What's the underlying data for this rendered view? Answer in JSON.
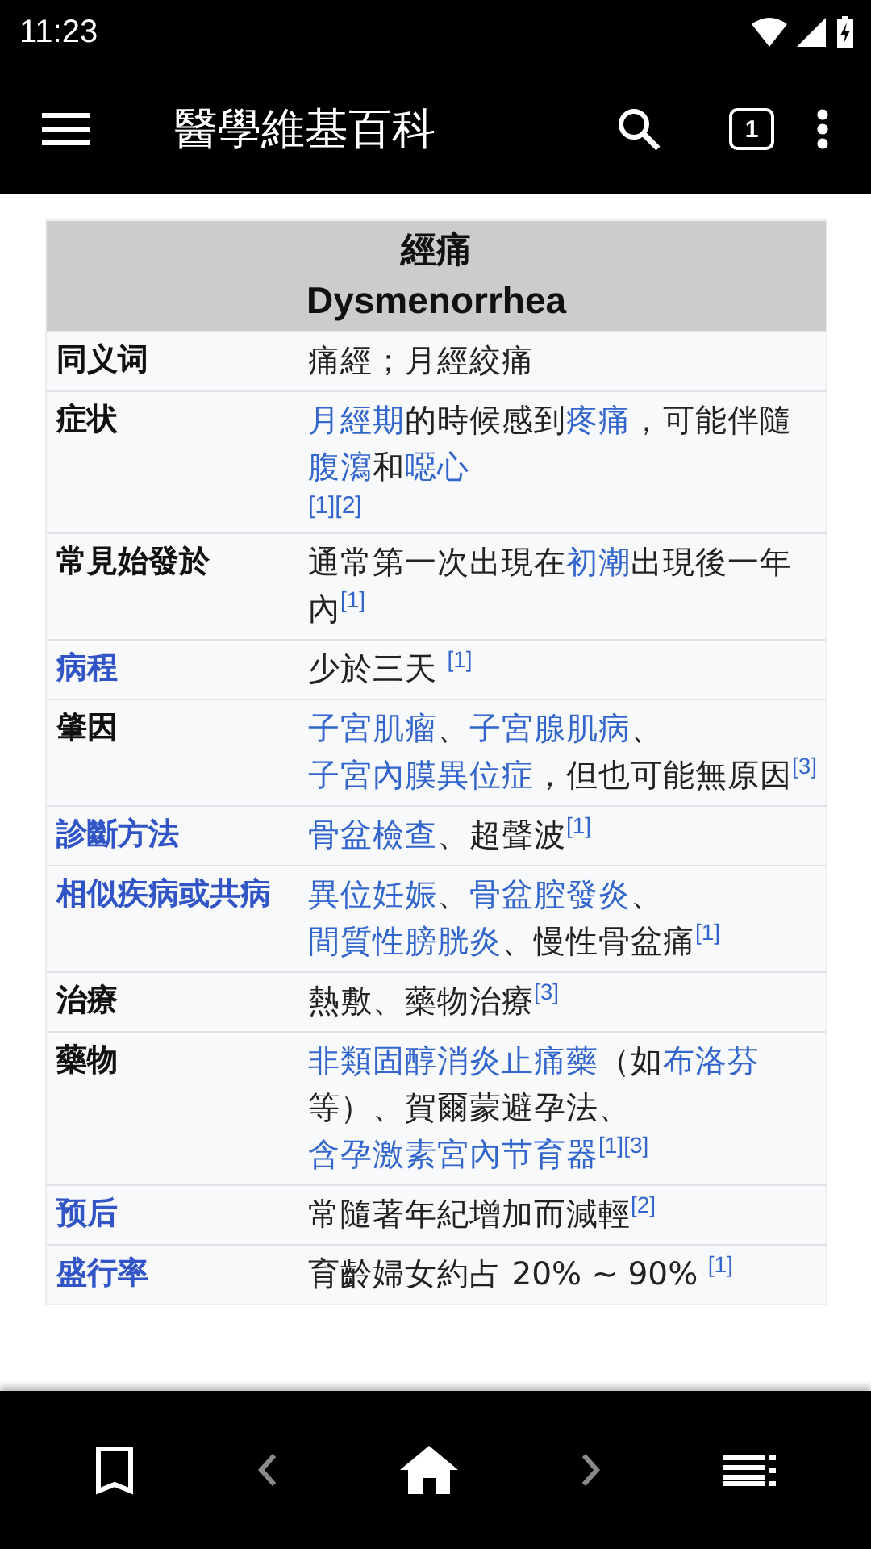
{
  "status_bar": {
    "time": "11:23"
  },
  "app_bar": {
    "title": "醫學維基百科",
    "tab_count": "1"
  },
  "infobox": {
    "title": "經痛",
    "subtitle": "Dysmenorrhea",
    "rows": [
      {
        "label": "同义词",
        "label_link": false,
        "value": [
          {
            "kind": "plain",
            "text": "痛經；月經絞痛"
          }
        ]
      },
      {
        "label": "症状",
        "label_link": false,
        "value": [
          {
            "kind": "link",
            "text": "月經期"
          },
          {
            "kind": "plain",
            "text": "的時候感到"
          },
          {
            "kind": "link",
            "text": "疼痛"
          },
          {
            "kind": "plain",
            "text": "，可能伴隨"
          },
          {
            "kind": "link",
            "text": "腹瀉"
          },
          {
            "kind": "plain",
            "text": "和"
          },
          {
            "kind": "link",
            "text": "噁心"
          },
          {
            "kind": "refline",
            "text": "[1][2]"
          }
        ]
      },
      {
        "label": "常見始發於",
        "label_link": false,
        "value": [
          {
            "kind": "plain",
            "text": "通常第一次出現在"
          },
          {
            "kind": "link",
            "text": "初潮"
          },
          {
            "kind": "plain",
            "text": "出現後一年內"
          },
          {
            "kind": "ref",
            "text": "[1]"
          }
        ]
      },
      {
        "label": "病程",
        "label_link": true,
        "value": [
          {
            "kind": "plain",
            "text": "少於三天 "
          },
          {
            "kind": "ref",
            "text": "[1]"
          }
        ]
      },
      {
        "label": "肇因",
        "label_link": false,
        "value": [
          {
            "kind": "link",
            "text": "子宮肌瘤"
          },
          {
            "kind": "plain",
            "text": "、"
          },
          {
            "kind": "link",
            "text": "子宮腺肌病"
          },
          {
            "kind": "plain",
            "text": "、"
          },
          {
            "kind": "link",
            "text": "子宮內膜異位症"
          },
          {
            "kind": "plain",
            "text": "，但也可能無原因"
          },
          {
            "kind": "ref",
            "text": "[3]"
          }
        ]
      },
      {
        "label": "診斷方法",
        "label_link": true,
        "value": [
          {
            "kind": "link",
            "text": "骨盆檢查"
          },
          {
            "kind": "plain",
            "text": "、超聲波"
          },
          {
            "kind": "ref",
            "text": "[1]"
          }
        ]
      },
      {
        "label": "相似疾病或共病",
        "label_link": true,
        "value": [
          {
            "kind": "link",
            "text": "異位妊娠"
          },
          {
            "kind": "plain",
            "text": "、"
          },
          {
            "kind": "link",
            "text": "骨盆腔發炎"
          },
          {
            "kind": "plain",
            "text": "、"
          },
          {
            "kind": "link",
            "text": "間質性膀胱炎"
          },
          {
            "kind": "plain",
            "text": "、慢性骨盆痛"
          },
          {
            "kind": "ref",
            "text": "[1]"
          }
        ]
      },
      {
        "label": "治療",
        "label_link": false,
        "value": [
          {
            "kind": "plain",
            "text": "熱敷、藥物治療"
          },
          {
            "kind": "ref",
            "text": "[3]"
          }
        ]
      },
      {
        "label": "藥物",
        "label_link": false,
        "value": [
          {
            "kind": "link",
            "text": "非類固醇消炎止痛藥"
          },
          {
            "kind": "plain",
            "text": "（如"
          },
          {
            "kind": "link",
            "text": "布洛芬"
          },
          {
            "kind": "plain",
            "text": "等）、賀爾蒙避孕法、"
          },
          {
            "kind": "link",
            "text": "含孕激素宮內节育器"
          },
          {
            "kind": "ref",
            "text": "[1][3]"
          }
        ]
      },
      {
        "label": "预后",
        "label_link": true,
        "value": [
          {
            "kind": "plain",
            "text": "常隨著年紀增加而減輕"
          },
          {
            "kind": "ref",
            "text": "[2]"
          }
        ]
      },
      {
        "label": "盛行率",
        "label_link": true,
        "value": [
          {
            "kind": "plain",
            "text": "育齡婦女約占 20% ~ 90% "
          },
          {
            "kind": "ref",
            "text": "[1]"
          }
        ]
      }
    ]
  },
  "bottom_nav": [
    {
      "kind": "bookmark",
      "disabled": false
    },
    {
      "kind": "back",
      "disabled": true
    },
    {
      "kind": "home",
      "disabled": false
    },
    {
      "kind": "forward",
      "disabled": true
    },
    {
      "kind": "contents",
      "disabled": false
    }
  ]
}
